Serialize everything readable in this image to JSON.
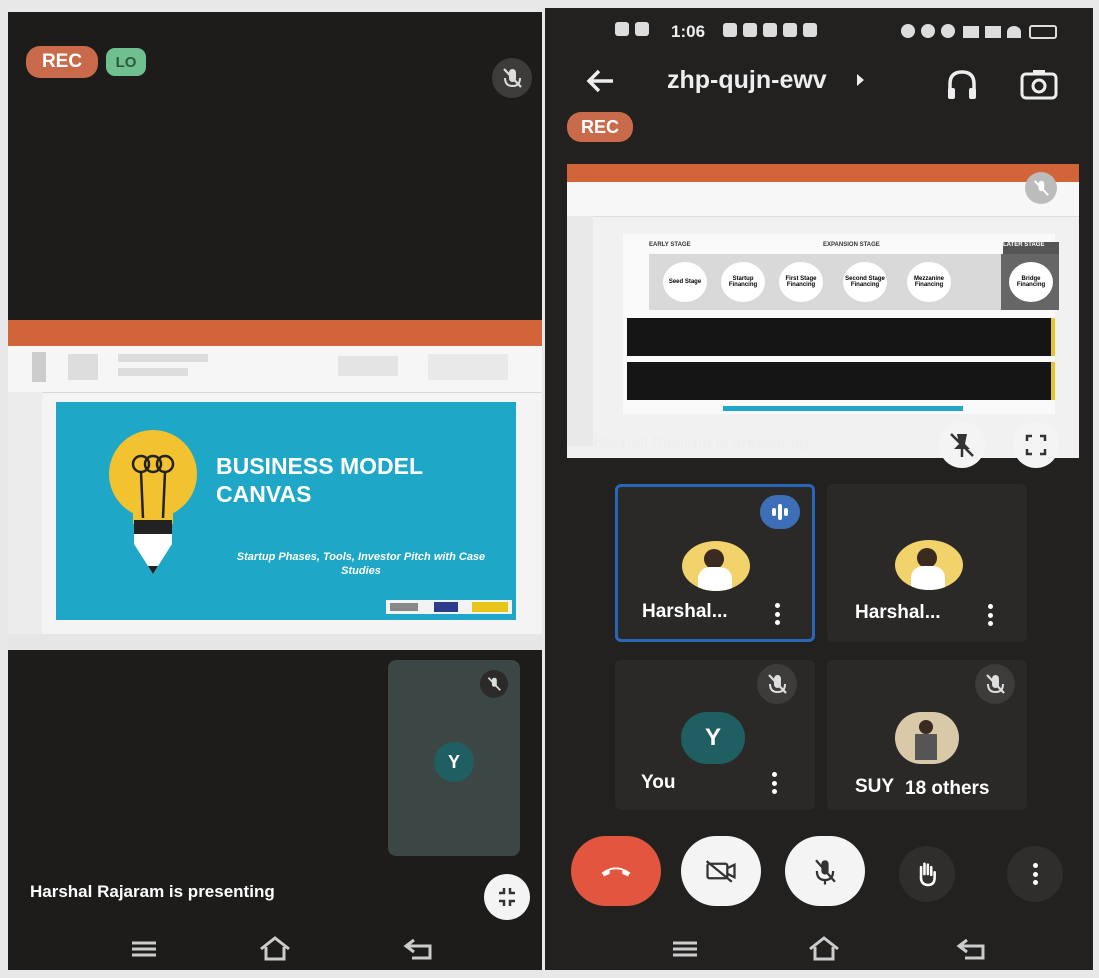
{
  "left_screen": {
    "rec_label": "REC",
    "live_label": "LO",
    "slide": {
      "title_line1": "BUSINESS MODEL",
      "title_line2": "CANVAS",
      "subtitle": "Startup Phases, Tools, Investor Pitch with Case Studies"
    },
    "self_tile_initial": "Y",
    "presenting_caption": "Harshal Rajaram is presenting"
  },
  "right_screen": {
    "status_time": "1:06",
    "meeting_code": "zhp-qujn-ewv",
    "rec_label": "REC",
    "presenting_caption": "Harshal Rajaram is presenting",
    "slide_labels": {
      "early_stage": "EARLY STAGE",
      "expansion_stage": "EXPANSION STAGE",
      "later_stage": "LATER STAGE",
      "steps": [
        "Seed Stage",
        "Startup Financing",
        "First Stage Financing",
        "Second Stage Financing",
        "Mezzanine Financing",
        "Bridge Financing"
      ]
    },
    "participants": [
      {
        "name": "Harshal..."
      },
      {
        "name": "Harshal..."
      },
      {
        "name": "You",
        "initial": "Y"
      },
      {
        "name": "SUY",
        "others": "18 others"
      }
    ]
  },
  "colors": {
    "rec": "#c96a4a",
    "live": "#6fbf8f",
    "slide_bg": "#1ea7c6",
    "bulb": "#f2c230",
    "end_call": "#e2563f",
    "active_border": "#2a66b8"
  }
}
